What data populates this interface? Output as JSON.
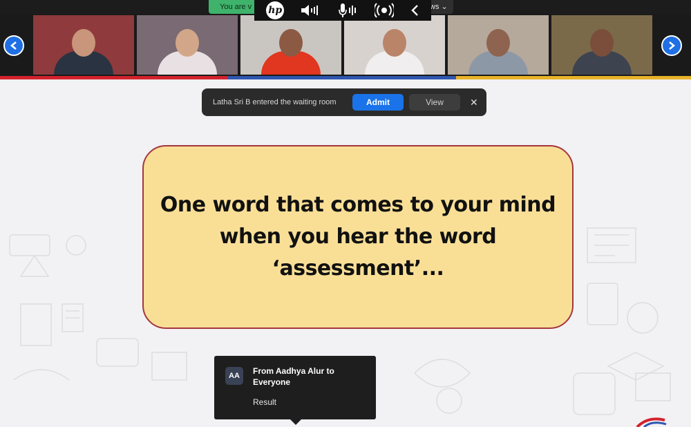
{
  "banner": {
    "left_text": "You are v",
    "right_text": "ws ⌄"
  },
  "media_bar": {
    "logo_text": "hp",
    "icons": [
      "volume-icon",
      "microphone-icon",
      "broadcast-icon",
      "chevron-left-icon"
    ]
  },
  "participants": [
    {
      "name": "participant-1",
      "bg": "#8f3a3c",
      "skin": "#c9967c",
      "shirt": "#2a3342"
    },
    {
      "name": "participant-2",
      "bg": "#7a6a73",
      "skin": "#d2a789",
      "shirt": "#e8e0e2"
    },
    {
      "name": "participant-3",
      "bg": "#c9c6c2",
      "skin": "#8c5a43",
      "shirt": "#e1361f"
    },
    {
      "name": "participant-4",
      "bg": "#d8d2cf",
      "skin": "#b98468",
      "shirt": "#f0eeee"
    },
    {
      "name": "participant-5",
      "bg": "#b5a99b",
      "skin": "#8e6350",
      "shirt": "#8d98a6"
    },
    {
      "name": "participant-6",
      "bg": "#7b6a4a",
      "skin": "#7a4e3b",
      "shirt": "#3e4350"
    }
  ],
  "waiting_room": {
    "message": "Latha Sri B entered the waiting room",
    "admit_label": "Admit",
    "view_label": "View",
    "close_glyph": "✕"
  },
  "slide": {
    "line1": "One word that comes to your mind",
    "line2": "when you hear the word",
    "line3": "‘assessment’..."
  },
  "chat": {
    "avatar_initials": "AA",
    "from_text": "From Aadhya Alur to Everyone",
    "message": "Result"
  },
  "colors": {
    "admit_blue": "#1a73e8",
    "nav_blue": "#1f6fe5",
    "card_fill": "#f9df96",
    "card_border": "#a3353d"
  }
}
